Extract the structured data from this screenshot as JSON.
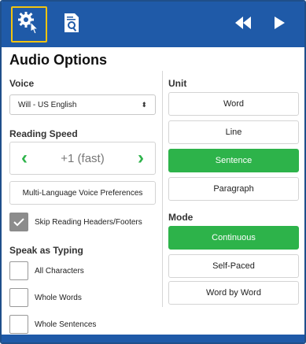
{
  "toolbar": {
    "settings_icon": "gear-pointer-icon",
    "reader_icon": "document-search-icon",
    "rewind_icon": "rewind-icon",
    "play_icon": "play-icon",
    "background": "#1f5aa8",
    "focus_color": "#f2c40f"
  },
  "panel": {
    "title": "Audio Options"
  },
  "voice": {
    "label": "Voice",
    "selected": "Will - US English"
  },
  "reading_speed": {
    "label": "Reading Speed",
    "value": "+1 (fast)",
    "decrease_icon": "chevron-left-icon",
    "increase_icon": "chevron-right-icon"
  },
  "multi_language": {
    "label": "Multi-Language Voice Preferences"
  },
  "skip_headers": {
    "label": "Skip Reading Headers/Footers",
    "checked": true
  },
  "speak_as_typing": {
    "label": "Speak as Typing",
    "options": [
      {
        "label": "All Characters",
        "checked": false
      },
      {
        "label": "Whole Words",
        "checked": false
      },
      {
        "label": "Whole Sentences",
        "checked": false
      }
    ]
  },
  "unit": {
    "label": "Unit",
    "options": [
      "Word",
      "Line",
      "Sentence",
      "Paragraph"
    ],
    "selected": "Sentence"
  },
  "mode": {
    "label": "Mode",
    "options": [
      "Continuous",
      "Self-Paced",
      "Word by Word"
    ],
    "selected": "Continuous"
  },
  "colors": {
    "accent_green": "#2db34a",
    "primary_blue": "#1f5aa8"
  }
}
